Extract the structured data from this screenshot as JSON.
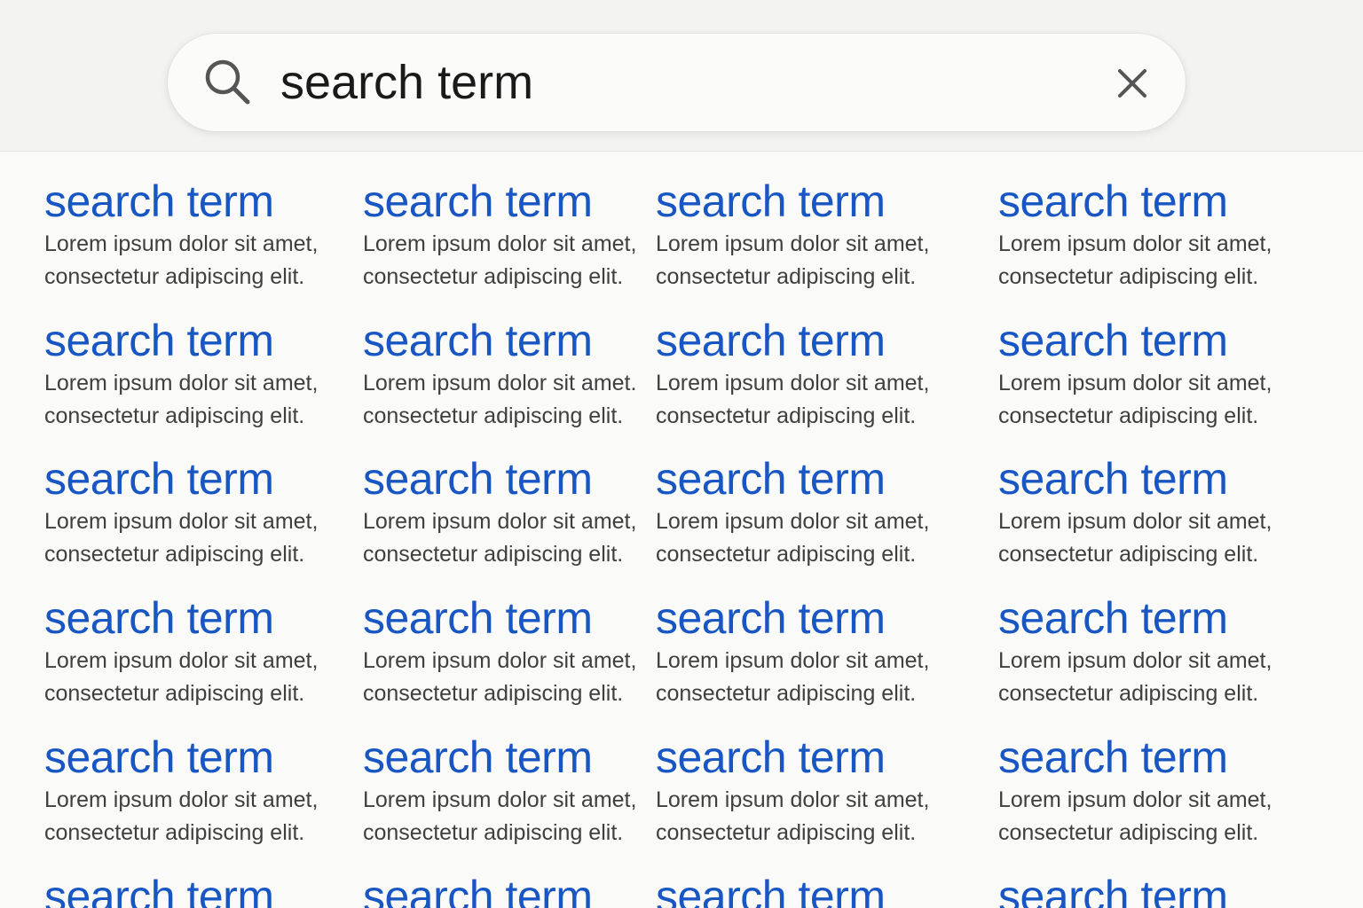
{
  "search": {
    "query": "search term",
    "search_icon": "search-icon",
    "clear_icon": "close-icon"
  },
  "colors": {
    "link": "#1856c4",
    "snippet": "#3f3f3f",
    "header_bg": "#f3f3f1",
    "page_bg": "#fafaf8"
  },
  "results": {
    "rows": [
      [
        {
          "title": "search term",
          "line1": "Lorem ipsum dolor sit amet,",
          "line2": "consectetur adipiscing elit."
        },
        {
          "title": "search term",
          "line1": "Lorem ipsum dolor sit amet,",
          "line2": "consectetur adipiscing elit."
        },
        {
          "title": "search term",
          "line1": "Lorem ipsum dolor sit amet,",
          "line2": "consectetur adipiscing elit."
        },
        {
          "title": "search term",
          "line1": "Lorem ipsum dolor sit amet,",
          "line2": "consectetur adipiscing elit."
        }
      ],
      [
        {
          "title": "search term",
          "line1": "Lorem ipsum dolor sit amet,",
          "line2": "consectetur adipiscing elit."
        },
        {
          "title": "search term",
          "line1": "Lorem ipsum dolor sit amet.",
          "line2": "consectetur adipiscing elit."
        },
        {
          "title": "search term",
          "line1": "Lorem ipsum dolor sit amet,",
          "line2": "consectetur adipiscing elit."
        },
        {
          "title": "search term",
          "line1": "Lorem ipsum dolor sit amet,",
          "line2": "consectetur adipiscing elit."
        }
      ],
      [
        {
          "title": "search term",
          "line1": "Lorem ipsum dolor sit amet,",
          "line2": "consectetur adipiscing elit."
        },
        {
          "title": "search term",
          "line1": "Lorem ipsum dolor sit amet,",
          "line2": "consectetur adipiscing elit."
        },
        {
          "title": "search term",
          "line1": "Lorem ipsum dolor sit amet,",
          "line2": "consectetur adipiscing elit."
        },
        {
          "title": "search term",
          "line1": "Lorem ipsum dolor sit amet,",
          "line2": "consectetur adipiscing elit."
        }
      ],
      [
        {
          "title": "search term",
          "line1": "Lorem ipsum dolor sit amet,",
          "line2": "consectetur adipiscing elit."
        },
        {
          "title": "search term",
          "line1": "Lorem ipsum dolor sit amet,",
          "line2": "consectetur adipiscing elit."
        },
        {
          "title": "search term",
          "line1": "Lorem ipsum dolor sit amet,",
          "line2": "consectetur adipiscing elit."
        },
        {
          "title": "search term",
          "line1": "Lorem ipsum dolor sit amet,",
          "line2": "consectetur adipiscing elit."
        }
      ],
      [
        {
          "title": "search term",
          "line1": "Lorem ipsum dolor sit amet,",
          "line2": "consectetur adipiscing elit."
        },
        {
          "title": "search term",
          "line1": "Lorem ipsum dolor sit amet,",
          "line2": "consectetur adipiscing elit."
        },
        {
          "title": "search term",
          "line1": "Lorem ipsum dolor sit amet,",
          "line2": "consectetur adipiscing elit."
        },
        {
          "title": "search term",
          "line1": "Lorem ipsum dolor sit amet,",
          "line2": "consectetur adipiscing elit."
        }
      ],
      [
        {
          "title": "search term",
          "line1": "",
          "line2": ""
        },
        {
          "title": "search term",
          "line1": "",
          "line2": ""
        },
        {
          "title": "search term",
          "line1": "",
          "line2": ""
        },
        {
          "title": "search term",
          "line1": "",
          "line2": ""
        }
      ]
    ]
  }
}
